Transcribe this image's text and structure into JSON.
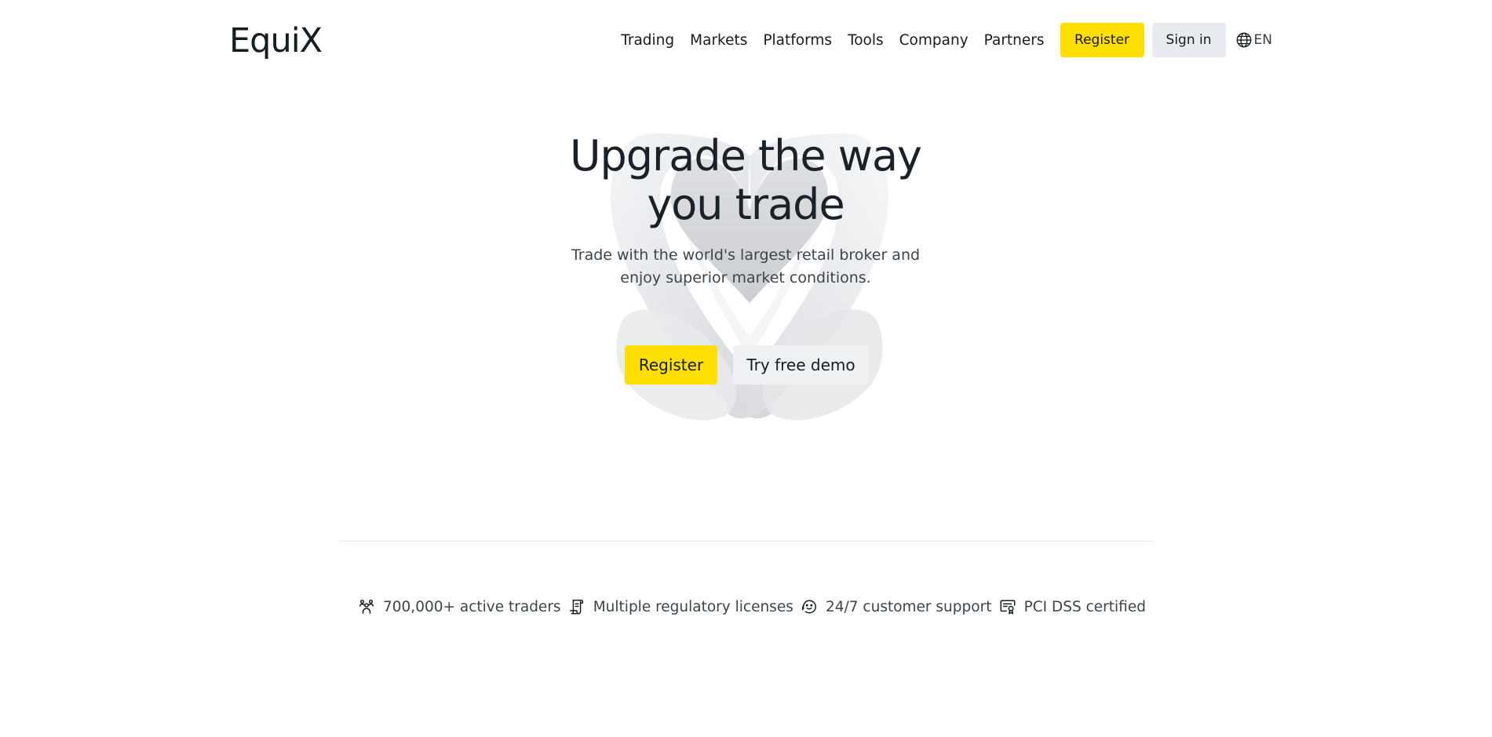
{
  "header": {
    "logo": "EquiX",
    "nav": [
      "Trading",
      "Markets",
      "Platforms",
      "Tools",
      "Company",
      "Partners"
    ],
    "register_label": "Register",
    "signin_label": "Sign in",
    "language": "EN"
  },
  "hero": {
    "title_line1": "Upgrade the way",
    "title_line2": "you trade",
    "subtitle_line1": "Trade with the world's largest retail broker and",
    "subtitle_line2": "enjoy superior market conditions.",
    "register_label": "Register",
    "demo_label": "Try free demo"
  },
  "features": [
    {
      "icon": "people-icon",
      "text": "700,000+ active traders"
    },
    {
      "icon": "license-icon",
      "text": "Multiple regulatory licenses"
    },
    {
      "icon": "support-icon",
      "text": "24/7 customer support"
    },
    {
      "icon": "certificate-icon",
      "text": "PCI DSS certified"
    }
  ],
  "colors": {
    "accent": "#ffde02",
    "secondary_button": "#e7eaee",
    "text": "#141d22"
  }
}
